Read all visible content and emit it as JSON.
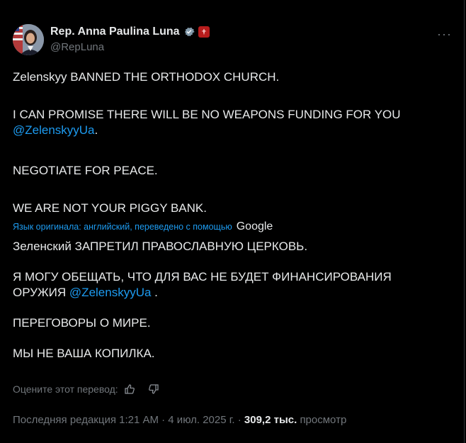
{
  "author": {
    "display_name": "Rep. Anna Paulina Luna",
    "handle": "@RepLuna",
    "verified_icon": "verified-badge-icon",
    "affiliation_icon": "us-house-badge-icon"
  },
  "menu": {
    "more_label": "···"
  },
  "original": {
    "line1": "Zelenskyy BANNED THE ORTHODOX CHURCH.",
    "line2": "I CAN PROMISE THERE WILL BE NO WEAPONS FUNDING FOR YOU",
    "mention": "@ZelenskyyUa",
    "mention_suffix": ".",
    "line3": "NEGOTIATE FOR PEACE.",
    "line4": "WE ARE NOT YOUR PIGGY BANK."
  },
  "translation": {
    "note": "Язык оригинала: английский, переведено с помощью",
    "provider": "Google",
    "line1": "Зеленский ЗАПРЕТИЛ ПРАВОСЛАВНУЮ ЦЕРКОВЬ.",
    "line2a": "Я МОГУ ОБЕЩАТЬ, ЧТО ДЛЯ ВАС НЕ БУДЕТ ФИНАНСИРОВАНИЯ",
    "line2b": "ОРУЖИЯ",
    "mention": "@ZelenskyyUa",
    "mention_suffix": " .",
    "line3": "ПЕРЕГОВОРЫ О МИРЕ.",
    "line4": "МЫ НЕ ВАША КОПИЛКА."
  },
  "rating": {
    "label": "Оцените этот перевод:"
  },
  "meta": {
    "edited": "Последняя редакция 1:21 AM · 4 июл. 2025 г. ·",
    "views_count": "309,2 тыс.",
    "views_label": "просмотр"
  },
  "colors": {
    "accent": "#1d9bf0",
    "muted": "#71767b",
    "text": "#e7e9ea",
    "background": "#000000"
  }
}
